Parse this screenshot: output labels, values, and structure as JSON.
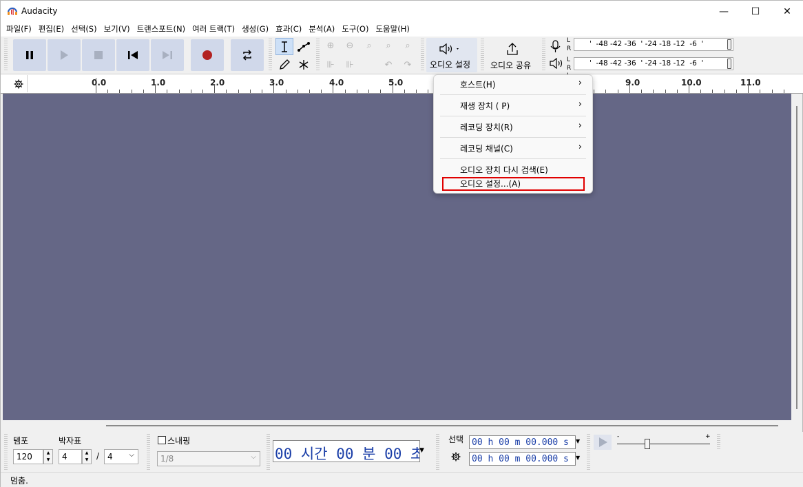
{
  "window": {
    "title": "Audacity",
    "minimize": "—",
    "maximize": "☐",
    "close": "✕"
  },
  "menu": [
    "파일(F)",
    "편집(E)",
    "선택(S)",
    "보기(V)",
    "트랜스포트(N)",
    "여러 트랙(T)",
    "생성(G)",
    "효과(C)",
    "분석(A)",
    "도구(O)",
    "도움말(H)"
  ],
  "toolbar": {
    "audio_setup_label": "오디오 설정",
    "share_label": "오디오 공유",
    "meter_rec": {
      "L": "L",
      "R": "R",
      "ticks": "'  -48 -42 -36  ' -24 -18 -12  -6  '"
    },
    "meter_play": {
      "L": "L",
      "R": "R",
      "ticks": "'  -48 -42 -36  ' -24 -18 -12  -6  '"
    }
  },
  "ruler": {
    "labels": [
      "0.0",
      "1.0",
      "2.0",
      "3.0",
      "4.0",
      "5.0",
      "9.0",
      "10.0",
      "11.0"
    ]
  },
  "dropdown": {
    "items": [
      {
        "label": "호스트(H)",
        "submenu": true
      },
      {
        "label": "재생 장치 ( P)",
        "submenu": true
      },
      {
        "label": "레코딩 장치(R)",
        "submenu": true
      },
      {
        "label": "레코딩 채널(C)",
        "submenu": true
      },
      {
        "label": "오디오 장치 다시 검색(E)",
        "submenu": false
      },
      {
        "label": "오디오 설정...(A)",
        "submenu": false,
        "highlighted": true
      }
    ]
  },
  "bottom": {
    "tempo_label": "템포",
    "tempo_value": "120",
    "timesig_label": "박자표",
    "timesig_num": "4",
    "timesig_slash": "/",
    "timesig_den": "4",
    "snap_label": "스내핑",
    "snap_value": "1/8",
    "time_display": "00 시간 00 분 00 초",
    "selection_label": "선택",
    "sel_start": "00 h 00 m 00.000 s",
    "sel_end": "00 h 00 m 00.000 s",
    "speed_min": "-",
    "speed_max": "+"
  },
  "status": {
    "text": "멈춤."
  },
  "colors": {
    "canvas": "#656786",
    "transport_btn": "#d0d8ea",
    "record": "#b22222",
    "highlight": "#e00000",
    "time_digits": "#1b3fa8"
  }
}
